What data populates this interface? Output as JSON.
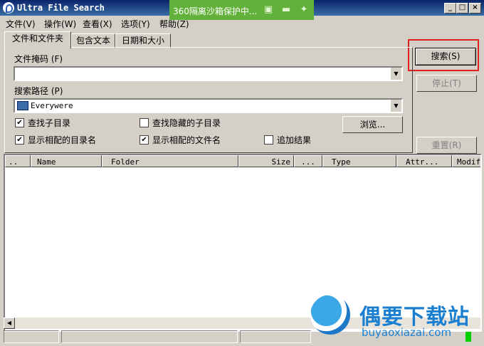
{
  "window": {
    "title": "Ultra File Search",
    "min": "_",
    "max": "□",
    "close": "×"
  },
  "sandbox": {
    "text": "360隔离沙箱保护中..."
  },
  "menu": [
    "文件(V)",
    "操作(W)",
    "查看(X)",
    "选项(Y)",
    "帮助(Z)"
  ],
  "tabs": [
    "文件和文件夹",
    "包含文本",
    "日期和大小"
  ],
  "form": {
    "file_mask_label": "文件掩码 (F)",
    "file_mask_value": "",
    "path_label": "搜索路径 (P)",
    "path_value": "Everywere",
    "checkboxes": [
      {
        "label": "查找子目录",
        "checked": true
      },
      {
        "label": "查找隐藏的子目录",
        "checked": false
      },
      {
        "label": "显示相配的目录名",
        "checked": true
      },
      {
        "label": "显示相配的文件名",
        "checked": true
      },
      {
        "label": "追加结果",
        "checked": false
      }
    ],
    "browse_label": "浏览..."
  },
  "buttons": {
    "search": "搜索(S)",
    "stop": "停止(T)",
    "reset": "重置(R)"
  },
  "columns": [
    "..",
    "Name",
    "Folder",
    "Size",
    "...",
    "Type",
    "Attr...",
    "Modif"
  ],
  "watermark": {
    "title": "偶要下载站",
    "url": "buyaoxiazai.com"
  },
  "colors": {
    "titlebar": "#0a246a",
    "sandbox": "#62b13b",
    "highlight": "#e02020"
  }
}
